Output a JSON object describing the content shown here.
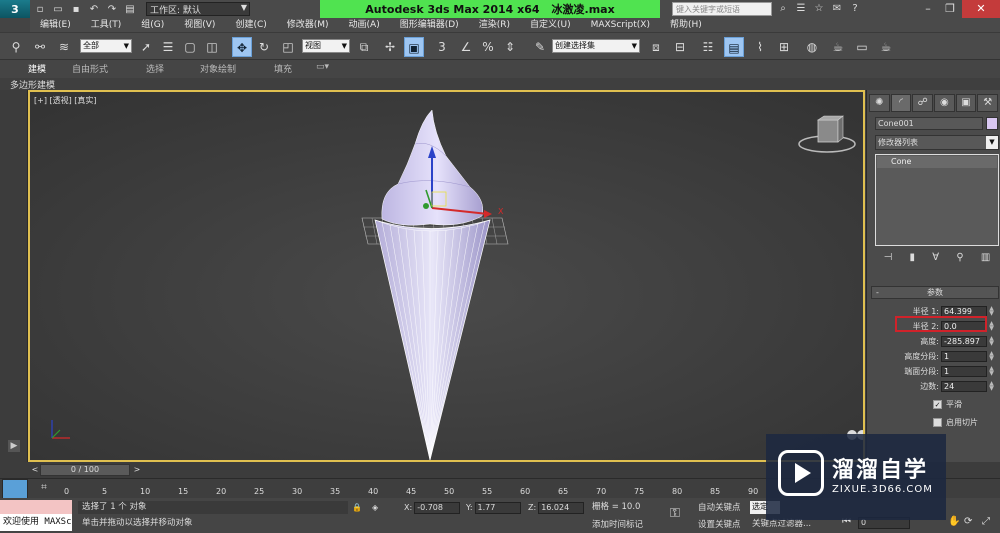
{
  "titlebar": {
    "workspace": "工作区: 默认",
    "app_name": "Autodesk 3ds Max  2014 x64",
    "file_name": "冰激凌.max",
    "search_placeholder": "键入关键字或短语"
  },
  "menu": [
    "编辑(E)",
    "工具(T)",
    "组(G)",
    "视图(V)",
    "创建(C)",
    "修改器(M)",
    "动画(A)",
    "图形编辑器(D)",
    "渲染(R)",
    "自定义(U)",
    "MAXScript(X)",
    "帮助(H)"
  ],
  "toolbar": {
    "selection_filter": "全部",
    "ref_coord": "视图",
    "named_selection": "创建选择集",
    "snap_value": "3"
  },
  "ribbon": {
    "tabs": [
      "建模",
      "自由形式",
      "选择",
      "对象绘制",
      "填充"
    ],
    "sub_label": "多边形建模"
  },
  "viewport": {
    "label": "[+] [透视] [真实]"
  },
  "command_panel": {
    "object_name": "Cone001",
    "object_color": "#d9c8f2",
    "modifier_list": "修改器列表",
    "stack_item": "Cone",
    "params_title": "参数",
    "params": [
      {
        "label": "半径 1:",
        "value": "64.399"
      },
      {
        "label": "半径 2:",
        "value": "0.0"
      },
      {
        "label": "高度:",
        "value": "-285.897"
      },
      {
        "label": "高度分段:",
        "value": "1"
      },
      {
        "label": "端面分段:",
        "value": "1"
      },
      {
        "label": "边数:",
        "value": "24"
      }
    ],
    "smooth_label": "平滑",
    "slice_label": "启用切片"
  },
  "timeline": {
    "frame_display": "0 / 100",
    "ticks": [
      "0",
      "5",
      "10",
      "15",
      "20",
      "25",
      "30",
      "35",
      "40",
      "45",
      "50",
      "55",
      "60",
      "65",
      "70",
      "75",
      "80",
      "85",
      "90"
    ]
  },
  "status": {
    "listener_text": "欢迎使用 MAXSc",
    "selection": "选择了 1 个 对象",
    "prompt": "单击并拖动以选择并移动对象",
    "x_label": "X:",
    "x": "-0.708",
    "y_label": "Y:",
    "y": "1.77",
    "z_label": "Z:",
    "z": "16.024",
    "grid": "栅格 = 10.0",
    "add_time_tag": "添加时间标记",
    "auto_key": "自动关键点",
    "set_key": "设置关键点",
    "selected_dd": "选定",
    "key_filters": "关键点过滤器...",
    "current_frame": "0"
  },
  "watermark": {
    "title": "溜溜自学",
    "url": "ZIXUE.3D66.COM"
  }
}
